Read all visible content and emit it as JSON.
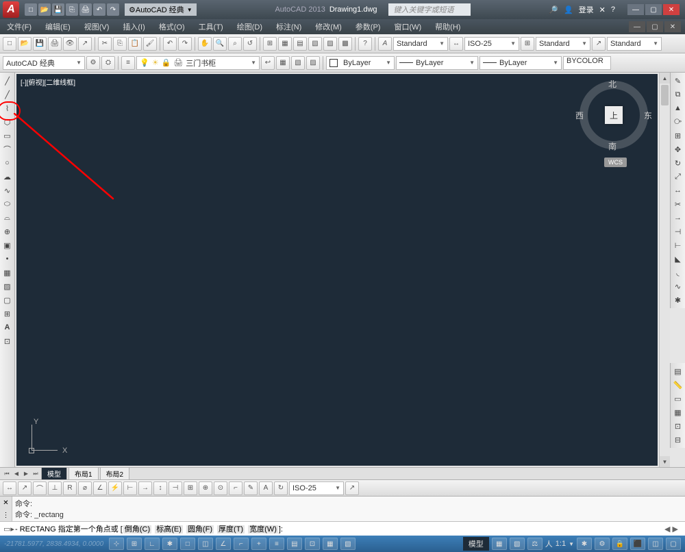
{
  "titlebar": {
    "app_logo": "A",
    "workspace_selector": "AutoCAD 经典",
    "app_name": "AutoCAD 2013",
    "document_name": "Drawing1.dwg",
    "search_placeholder": "键入关键字或短语",
    "login_label": "登录"
  },
  "menubar": {
    "items": [
      "文件(F)",
      "编辑(E)",
      "视图(V)",
      "插入(I)",
      "格式(O)",
      "工具(T)",
      "绘图(D)",
      "标注(N)",
      "修改(M)",
      "参数(P)",
      "窗口(W)",
      "帮助(H)"
    ]
  },
  "toolbar1": {
    "style_std": "Standard",
    "style_iso": "ISO-25",
    "style_std2": "Standard",
    "style_std3": "Standard"
  },
  "toolbar2": {
    "workspace": "AutoCAD 经典",
    "layer_dropdown": "三门书柜",
    "bylayer1": "ByLayer",
    "bylayer2": "ByLayer",
    "bylayer3": "ByLayer",
    "bycolor": "BYCOLOR"
  },
  "canvas": {
    "viewport_label": "[-][俯视][二维线框]",
    "viewcube": {
      "top": "上",
      "n": "北",
      "s": "南",
      "e": "东",
      "w": "西"
    },
    "wcs": "WCS",
    "axis_x": "X",
    "axis_y": "Y"
  },
  "tabs": {
    "model": "模型",
    "layout1": "布局1",
    "layout2": "布局2"
  },
  "toolbar_bottom": {
    "dim_style": "ISO-25"
  },
  "command": {
    "line1": "命令:",
    "line2": "命令: _rectang",
    "prompt_prefix": "- RECTANG 指定第一个角点或 [",
    "options": [
      "倒角(C)",
      "标高(E)",
      "圆角(F)",
      "厚度(T)",
      "宽度(W)"
    ],
    "prompt_suffix": "]:"
  },
  "status": {
    "coords": "-21781.5977, 2838.4934, 0.0000",
    "model_label": "模型",
    "scale": "1:1",
    "person": "人"
  },
  "colors": {
    "canvas_bg": "#1e2b38",
    "annotation": "#ff0000",
    "status_bg": "#2a5f90"
  }
}
